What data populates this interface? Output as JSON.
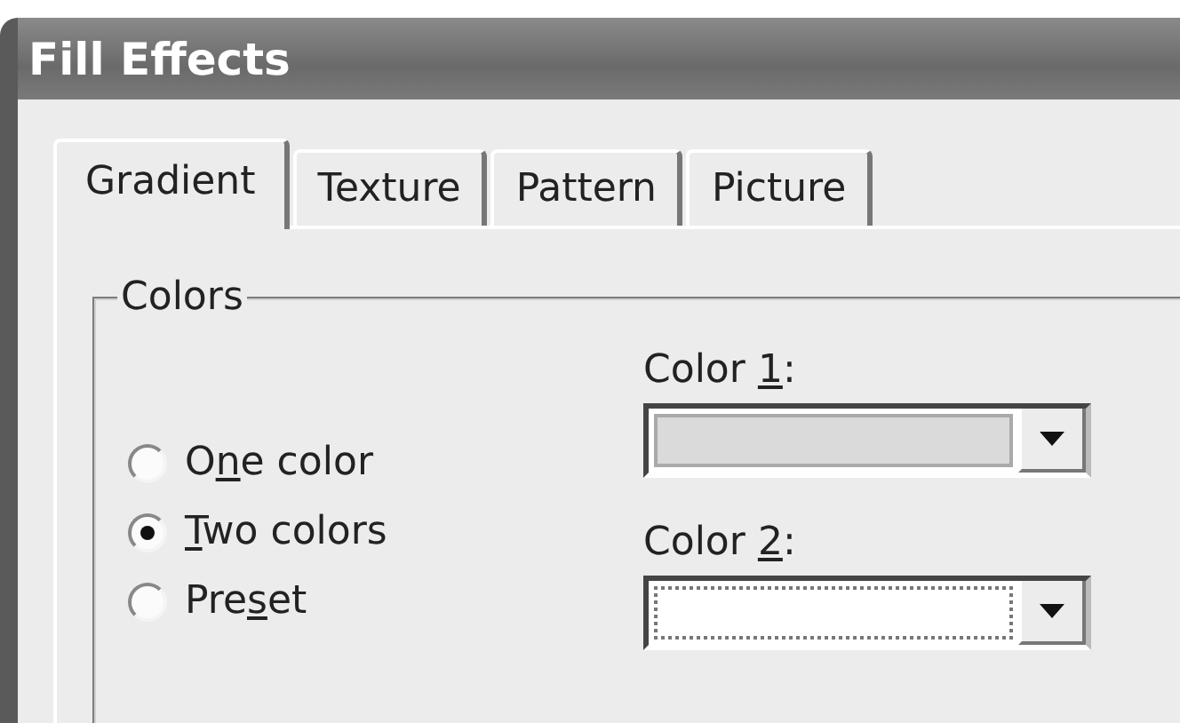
{
  "window": {
    "title": "Fill Effects"
  },
  "tabs": [
    {
      "label": "Gradient",
      "selected": true
    },
    {
      "label": "Texture",
      "selected": false
    },
    {
      "label": "Pattern",
      "selected": false
    },
    {
      "label": "Picture",
      "selected": false
    }
  ],
  "colors_group": {
    "title": "Colors",
    "options": [
      {
        "label": {
          "before": "O",
          "access_key": "n",
          "after": "e color"
        },
        "selected": false
      },
      {
        "label": {
          "access_key": "T",
          "after": "wo colors"
        },
        "selected": true
      },
      {
        "label": {
          "before": "Pre",
          "access_key": "s",
          "after": "et"
        },
        "selected": false
      }
    ],
    "pickers": [
      {
        "label": {
          "before": "Color ",
          "access_key": "1",
          "after": ":"
        },
        "color": "#dadada",
        "focused": false
      },
      {
        "label": {
          "before": "Color ",
          "access_key": "2",
          "after": ":"
        },
        "color": "#ffffff",
        "focused": true
      }
    ]
  }
}
